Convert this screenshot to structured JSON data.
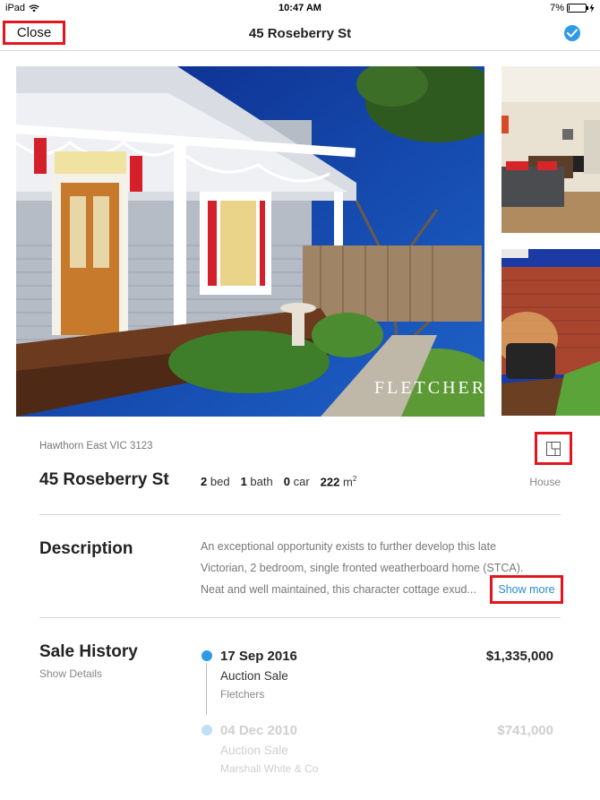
{
  "status_bar": {
    "device": "iPad",
    "time": "10:47 AM",
    "battery": "7%",
    "battery_level": 0.07
  },
  "nav": {
    "close_label": "Close",
    "title": "45 Roseberry St"
  },
  "photos": {
    "watermark": "FLETCHERS"
  },
  "listing": {
    "suburb": "Hawthorn East VIC 3123",
    "address": "45 Roseberry St",
    "beds": "2",
    "beds_label": "bed",
    "baths": "1",
    "baths_label": "bath",
    "cars": "0",
    "cars_label": "car",
    "land": "222",
    "land_unit": "m",
    "land_sup": "2",
    "type": "House"
  },
  "description": {
    "title": "Description",
    "line1": "An exceptional opportunity exists to further develop this late",
    "line2": "Victorian, 2 bedroom, single fronted weatherboard home (STCA).",
    "line3": "Neat and well maintained, this character cottage exud...",
    "show_more": "Show more"
  },
  "sale_history": {
    "title": "Sale History",
    "show_details": "Show Details",
    "entries": [
      {
        "date": "17 Sep 2016",
        "type": "Auction Sale",
        "agent": "Fletchers",
        "price": "$1,335,000"
      },
      {
        "date": "04 Dec 2010",
        "type": "Auction Sale",
        "agent": "Marshall White & Co",
        "price": "$741,000"
      }
    ]
  },
  "colors": {
    "accent": "#2f9be6",
    "highlight_box": "#e3161f",
    "link": "#2a8ad2"
  }
}
